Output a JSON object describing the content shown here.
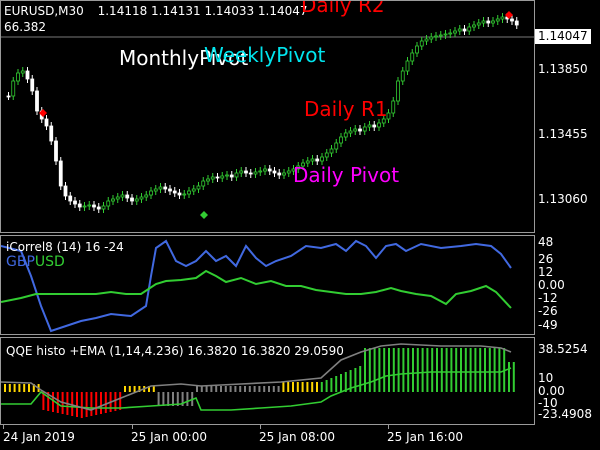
{
  "header": {
    "symbol": "EURUSD,M30",
    "ohlc": "1.14118 1.14131 1.14033 1.14047",
    "sub_value": "66.382"
  },
  "price_axis": {
    "current_price": "1.14047",
    "levels": [
      "1.13850",
      "1.13455",
      "1.13060"
    ]
  },
  "pivot_labels": {
    "daily_r2": "Daily R2",
    "monthly": "MonthlyPivot",
    "weekly": "WeeklyPivot",
    "daily_r1": "Daily R1",
    "daily_pivot": "Daily Pivot"
  },
  "correl_pane": {
    "title": "iCorrel8 (14)  16 -24",
    "legend_gbp": "GBP",
    "legend_usd": "USD",
    "axis": [
      "48",
      "26",
      "12",
      "0.00",
      "-12",
      "-26",
      "-49"
    ]
  },
  "qqe_pane": {
    "title": "QQE histo +EMA (1,14,4.236) 16.3820 16.3820 29.0590",
    "axis": [
      "38.5254",
      "10",
      "0.00",
      "-10",
      "-23.4908"
    ]
  },
  "time_axis": [
    "24 Jan 2019",
    "25 Jan 00:00",
    "25 Jan 08:00",
    "25 Jan 16:00"
  ],
  "colors": {
    "background": "#000000",
    "bull_candle": "#32cd32",
    "bear_candle": "#ffffff",
    "daily_r2": "#ff0000",
    "monthly_pivot": "#ffffff",
    "weekly_pivot": "#00e5ee",
    "daily_r1": "#ff0000",
    "daily_pivot": "#ff00ff",
    "gbp_line": "#4169e1",
    "usd_line": "#32cd32",
    "qqe_green": "#32cd32",
    "qqe_red": "#ff0000",
    "qqe_yellow": "#ffd700",
    "qqe_gray": "#808080"
  }
}
